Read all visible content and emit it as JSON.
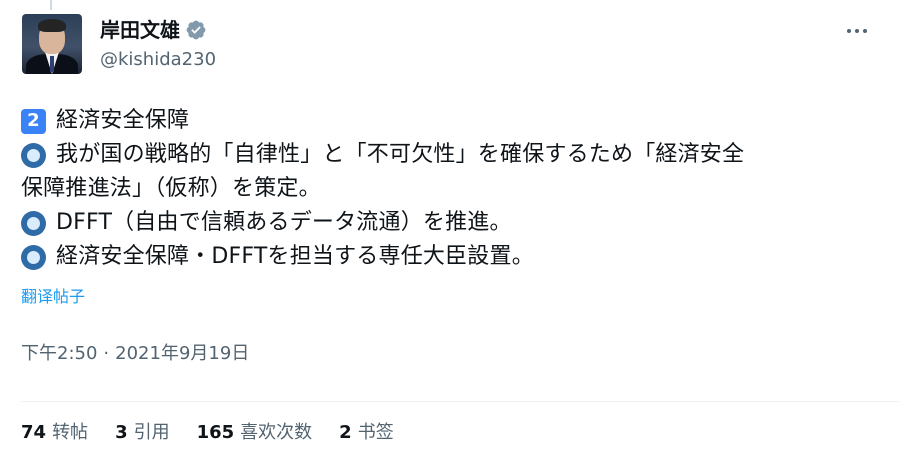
{
  "author": {
    "display_name": "岸田文雄",
    "handle": "@kishida230",
    "verified_badge_color": "#829aab"
  },
  "tweet": {
    "lines": [
      {
        "icon": "keycap-2-icon",
        "icon_text": "2",
        "text": "経済安全保障"
      },
      {
        "icon": "blue-circle-icon",
        "text": "我が国の戦略的「自律性」と「不可欠性」を確保するため「経済安全"
      },
      {
        "icon": null,
        "text": "保障推進法」（仮称）を策定。"
      },
      {
        "icon": "blue-circle-icon",
        "text": "DFFT（自由で信頼あるデータ流通）を推進。"
      },
      {
        "icon": "blue-circle-icon",
        "text": "経済安全保障・DFFTを担当する専任大臣設置。"
      }
    ],
    "translate_label": "翻译帖子",
    "time": "下午2:50",
    "separator": "·",
    "date": "2021年9月19日"
  },
  "stats": [
    {
      "count": "74",
      "label": "转帖"
    },
    {
      "count": "3",
      "label": "引用"
    },
    {
      "count": "165",
      "label": "喜欢次数"
    },
    {
      "count": "2",
      "label": "书签"
    }
  ],
  "colors": {
    "link": "#1d9bf0",
    "secondary_text": "#536471",
    "primary_text": "#0f1419"
  }
}
